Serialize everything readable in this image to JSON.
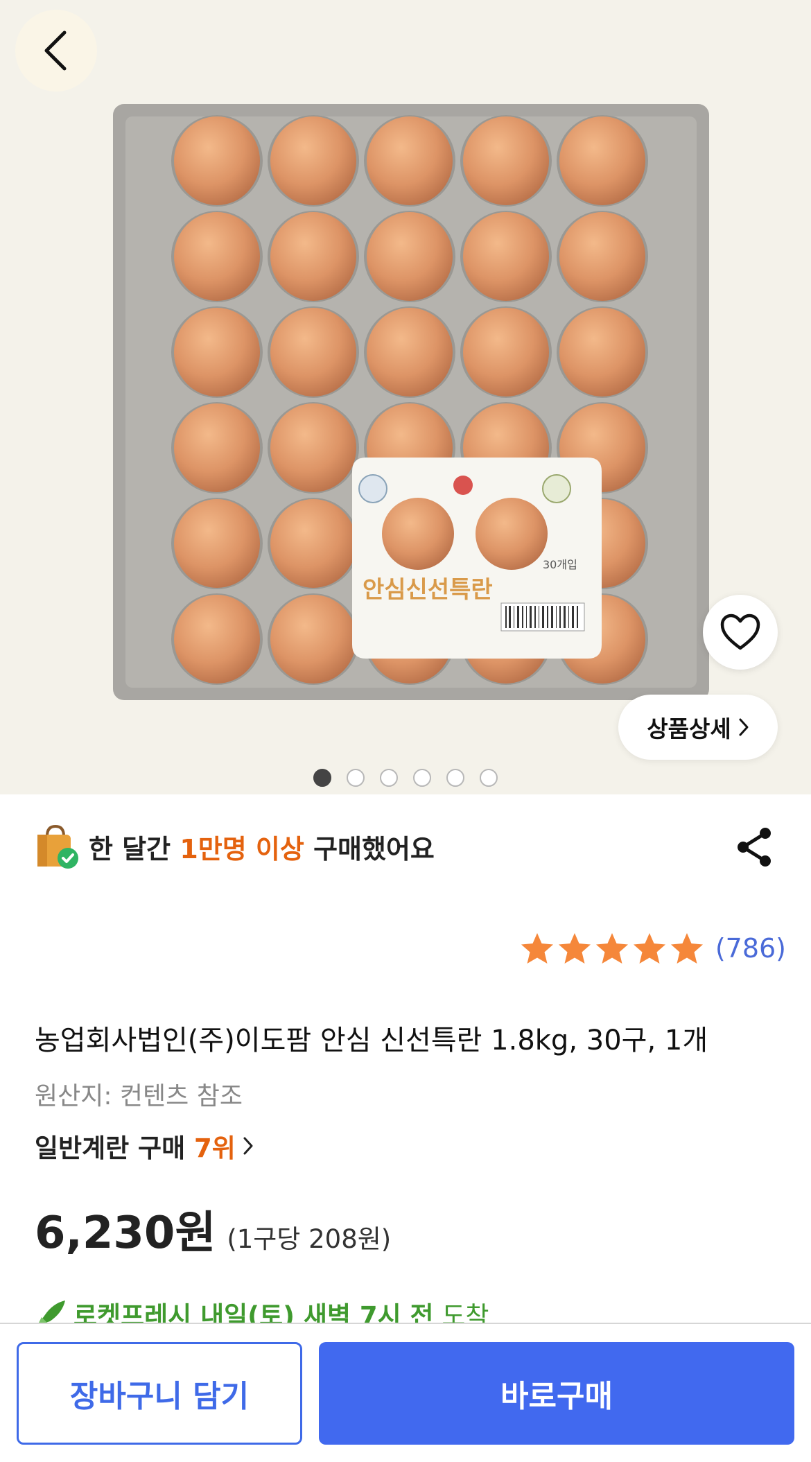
{
  "product_image": {
    "alt": "egg-tray-photo",
    "label_text": "안심신선특란",
    "label_count": "30개입",
    "image_count": 6,
    "active_index": 0
  },
  "buttons": {
    "detail_label": "상품상세",
    "cart_label": "장바구니 담기",
    "buy_label": "바로구매"
  },
  "buyers": {
    "prefix": "한 달간 ",
    "highlight": "1만명 이상",
    "suffix": " 구매했어요"
  },
  "rating": {
    "stars": 5,
    "review_count": "(786)"
  },
  "product": {
    "title": "농업회사법인(주)이도팜 안심 신선특란 1.8kg, 30구, 1개",
    "origin": "원산지: 컨텐츠 참조",
    "rank_prefix": "일반계란 구매 ",
    "rank_value": "7위"
  },
  "price": {
    "amount": "6,230원",
    "unit": "(1구당 208원)"
  },
  "delivery": {
    "bold": "로켓프레시 내일(토) 새벽 7시 전",
    "light": " 도착"
  },
  "colors": {
    "accent_orange": "#e4620e",
    "primary_blue": "#4169ef",
    "star_orange": "#f5873a",
    "delivery_green": "#3f9a2e"
  }
}
